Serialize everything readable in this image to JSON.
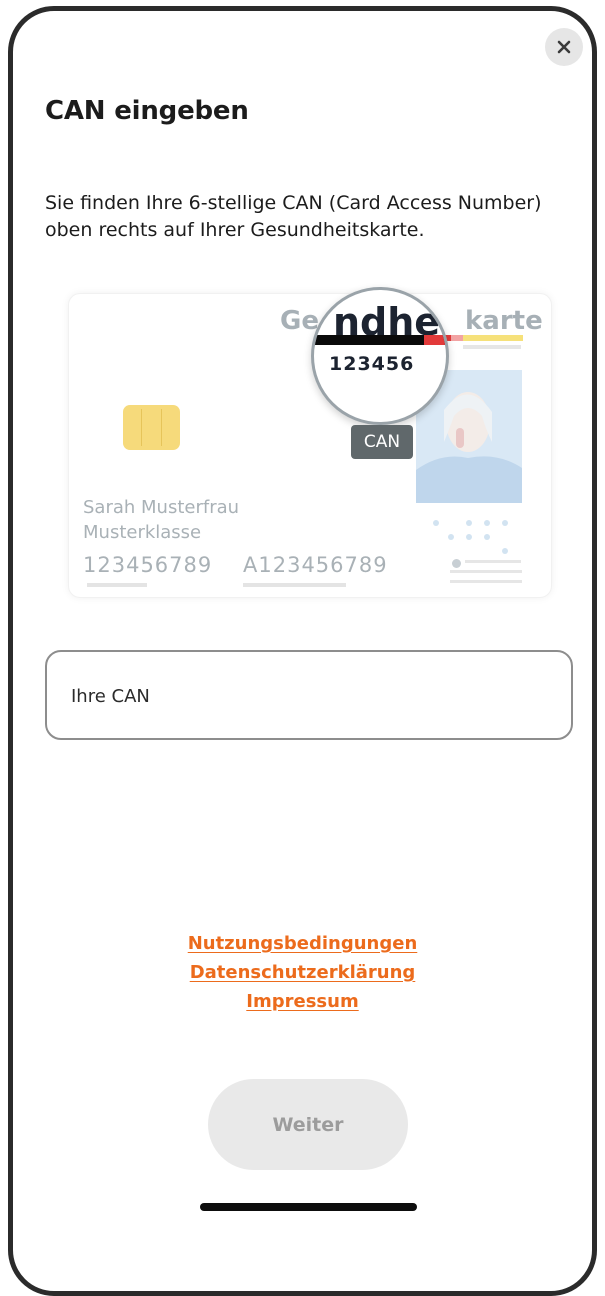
{
  "screen": {
    "close_icon": "close-icon",
    "title": "CAN eingeben",
    "description": "Sie finden Ihre 6-stellige CAN (Card Access Number) oben rechts auf Ihrer Gesundheitskarte."
  },
  "card": {
    "title_left": "Ge",
    "title_right": "karte",
    "magnified_text": "ndhe",
    "magnified_can": "123456",
    "can_badge": "CAN",
    "holder_name": "Sarah Musterfrau",
    "holder_class": "Musterklasse",
    "number_1": "123456789",
    "number_2": "A123456789"
  },
  "form": {
    "can_placeholder": "Ihre CAN",
    "can_value": ""
  },
  "links": {
    "terms": "Nutzungsbedingungen",
    "privacy": "Datenschutzerklärung",
    "imprint": "Impressum"
  },
  "actions": {
    "continue_label": "Weiter",
    "continue_enabled": false
  },
  "colors": {
    "link_accent": "#ec6b1c",
    "disabled_button_bg": "#e9e9e9",
    "disabled_button_text": "#9c9c9c"
  }
}
